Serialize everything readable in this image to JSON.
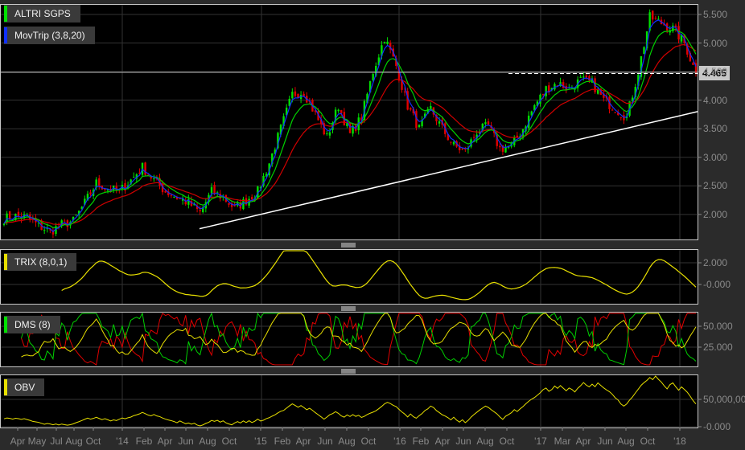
{
  "instrument": {
    "name": "ALTRI SGPS",
    "color": "#00e000"
  },
  "overlay": {
    "name": "MovTrip (3,8,20)",
    "color": "#1030ff"
  },
  "last_price": "4.465",
  "price_axis": [
    "5.500",
    "5.000",
    "4.500",
    "4.000",
    "3.500",
    "3.000",
    "2.500",
    "2.000"
  ],
  "trix": {
    "name": "TRIX (8,0,1)",
    "color": "#e8e000",
    "ticks": [
      "2.000",
      "-0.000"
    ]
  },
  "dms": {
    "name": "DMS (8)",
    "color": "#00e000",
    "ticks": [
      "50.000",
      "25.000"
    ]
  },
  "obv": {
    "name": "OBV",
    "color": "#e8e000",
    "ticks": [
      "50,000,000",
      "-0.000"
    ]
  },
  "x_labels": [
    "Apr",
    "May",
    "Jul",
    "Aug",
    "Oct",
    "'14",
    "Feb",
    "Apr",
    "Jun",
    "Aug",
    "Oct",
    "'15",
    "Feb",
    "Apr",
    "Jun",
    "Aug",
    "Oct",
    "'16",
    "Feb",
    "Apr",
    "Jun",
    "Aug",
    "Oct",
    "'17",
    "Mar",
    "Apr",
    "Jun",
    "Aug",
    "Oct",
    "'18"
  ],
  "chart_data": {
    "type": "candlestick",
    "series_name": "ALTRI SGPS",
    "period": "monthly approx closes Mar 2013 - Feb 2018",
    "closes": [
      1.93,
      1.97,
      1.95,
      1.8,
      1.7,
      1.82,
      1.88,
      2.2,
      2.55,
      2.45,
      2.4,
      2.6,
      2.83,
      2.6,
      2.4,
      2.3,
      2.2,
      2.03,
      2.4,
      2.3,
      2.1,
      2.25,
      2.4,
      2.9,
      3.5,
      4.1,
      4.15,
      3.75,
      3.35,
      3.9,
      3.4,
      3.7,
      4.5,
      5.1,
      4.6,
      3.9,
      3.5,
      3.85,
      3.5,
      3.2,
      3.1,
      3.45,
      3.55,
      3.15,
      3.2,
      3.5,
      3.9,
      4.2,
      4.3,
      4.2,
      4.35,
      4.3,
      4.0,
      3.85,
      3.7,
      4.5,
      5.45,
      5.35,
      5.25,
      5.0,
      4.465
    ],
    "moving_averages": [
      3,
      8,
      20
    ],
    "ylim": [
      1.6,
      5.7
    ],
    "trendline": {
      "from": 1.75,
      "to": 3.8
    },
    "colors": {
      "up": "#00e000",
      "down": "#e00000",
      "ma3": "#1030ff",
      "ma8": "#00d000",
      "ma20": "#d00000"
    }
  }
}
